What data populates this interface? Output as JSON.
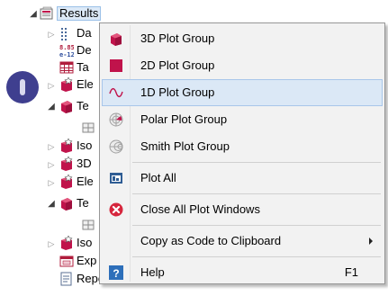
{
  "tree": {
    "root": {
      "label": "Results",
      "icon": "results-folder-icon"
    },
    "rows": [
      {
        "label": "Da",
        "icon": "datasets-icon",
        "toggle": "collapsed"
      },
      {
        "label": "De",
        "icon": "derived-values-icon",
        "toggle": "none"
      },
      {
        "label": "Ta",
        "icon": "tables-icon",
        "toggle": "none"
      },
      {
        "label": "Ele",
        "icon": "plot-group-icon",
        "toggle": "collapsed"
      },
      {
        "label": "Te",
        "icon": "3d-plot-group-icon",
        "toggle": "expanded"
      },
      {
        "label": "",
        "icon": "surface-child-icon",
        "toggle": "none"
      },
      {
        "label": "Iso",
        "icon": "plot-group-icon",
        "toggle": "collapsed"
      },
      {
        "label": "3D",
        "icon": "plot-group-icon",
        "toggle": "collapsed"
      },
      {
        "label": "Ele",
        "icon": "plot-group-icon",
        "toggle": "collapsed"
      },
      {
        "label": "Te",
        "icon": "3d-plot-group-icon",
        "toggle": "expanded"
      },
      {
        "label": "",
        "icon": "surface-child-icon",
        "toggle": "none"
      },
      {
        "label": "Iso",
        "icon": "plot-group-icon",
        "toggle": "collapsed"
      },
      {
        "label": "Exp",
        "icon": "export-icon",
        "toggle": "none"
      },
      {
        "label": "Reports",
        "icon": "reports-icon",
        "toggle": "none"
      }
    ]
  },
  "context_menu": {
    "items": [
      {
        "type": "item",
        "label": "3D Plot Group",
        "icon": "3d-plot-group-icon",
        "shortcut": "",
        "highlighted": false
      },
      {
        "type": "item",
        "label": "2D Plot Group",
        "icon": "2d-plot-group-icon",
        "shortcut": "",
        "highlighted": false
      },
      {
        "type": "item",
        "label": "1D Plot Group",
        "icon": "1d-plot-group-icon",
        "shortcut": "",
        "highlighted": true
      },
      {
        "type": "item",
        "label": "Polar Plot Group",
        "icon": "polar-plot-group-icon",
        "shortcut": "",
        "highlighted": false
      },
      {
        "type": "item",
        "label": "Smith Plot Group",
        "icon": "smith-plot-group-icon",
        "shortcut": "",
        "highlighted": false
      },
      {
        "type": "separator"
      },
      {
        "type": "item",
        "label": "Plot All",
        "icon": "plot-all-icon",
        "shortcut": "",
        "highlighted": false
      },
      {
        "type": "separator"
      },
      {
        "type": "item",
        "label": "Close All Plot Windows",
        "icon": "close-circle-icon",
        "shortcut": "",
        "highlighted": false
      },
      {
        "type": "separator"
      },
      {
        "type": "item",
        "label": "Copy as Code to Clipboard",
        "icon": "",
        "shortcut": "",
        "submenu": true,
        "highlighted": false
      },
      {
        "type": "separator"
      },
      {
        "type": "item",
        "label": "Help",
        "icon": "help-icon",
        "shortcut": "F1",
        "highlighted": false
      }
    ]
  },
  "colors": {
    "menu_background": "#f2f2f2",
    "menu_border": "#979797",
    "highlight_background": "#dbe8f6",
    "highlight_border": "#a8c6ea",
    "plot_group_red": "#c0134b",
    "help_blue": "#2d6fba",
    "close_red": "#d6263d",
    "step_badge": "#3f3f8f"
  }
}
